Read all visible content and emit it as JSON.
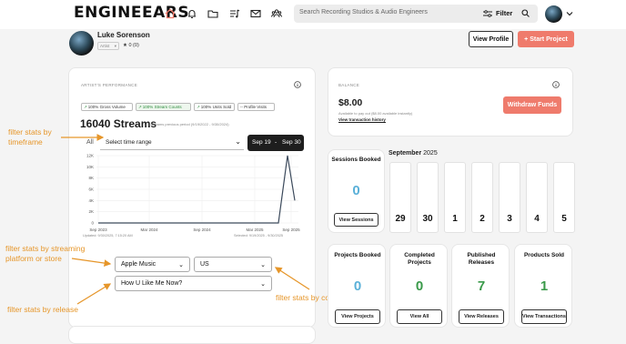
{
  "header": {
    "logo": "ENGINEEARS",
    "search": {
      "placeholder": "Search Recording Studios & Audio Engineers"
    },
    "filter_label": "Filter"
  },
  "profile": {
    "name": "Luke Sorenson",
    "role": "Artist",
    "rating": "0 (0)",
    "view_profile_label": "View Profile",
    "start_project_label": "+ Start Project"
  },
  "performance": {
    "section_title": "ARTIST'S PERFORMANCE",
    "chips": [
      {
        "value": "100%",
        "label": "Gross Volume"
      },
      {
        "value": "100%",
        "label": "Stream Counts"
      },
      {
        "value": "100%",
        "label": "Units Sold"
      },
      {
        "value": "--",
        "label": "Profile Visits"
      }
    ],
    "streams_value": "16040 Streams",
    "streams_note": "0 Streams previous period (9/19/2022 - 9/30/2024)",
    "all_label": "All",
    "time_range_label": "Select time range",
    "date_start": "Sep 19",
    "date_sep": "-",
    "date_end": "Sep 30",
    "updated_note": "Updated: 9/30/2025, 7:15:20 AM",
    "selected_note": "Selected: 9/19/2025 - 9/30/2025",
    "platform_value": "Apple Music",
    "country_value": "US",
    "release_value": "How U Like Me Now?"
  },
  "chart_data": {
    "type": "line",
    "y_ticks": [
      "12K",
      "10K",
      "8K",
      "6K",
      "4K",
      "2K",
      "0"
    ],
    "x_ticks": [
      "Sep 2023",
      "Mar 2024",
      "Sep 2024",
      "Mar 2025",
      "Sep 2025"
    ],
    "ylim": [
      0,
      12000
    ],
    "series": [
      {
        "x": [
          "Sep 2023",
          "Mar 2024",
          "Sep 2024",
          "Mar 2025",
          "Aug 2025",
          "Sep 2025",
          "Sep 2025"
        ],
        "values": [
          0,
          0,
          0,
          0,
          0,
          12000,
          4000
        ]
      }
    ],
    "grid": true,
    "color": "#3c4a5c"
  },
  "balance": {
    "section_title": "BALANCE",
    "amount": "$8.00",
    "available_note": "Available to pay out ($8.00 available instantly)",
    "history_link": "View transaction history",
    "withdraw_label": "Withdraw Funds"
  },
  "sessions": {
    "title": "Sessions Booked",
    "value": "0",
    "button": "View Sessions"
  },
  "calendar": {
    "month": "September",
    "year": "2025",
    "days": [
      "29",
      "30",
      "1",
      "2",
      "3",
      "4",
      "5"
    ]
  },
  "stats": [
    {
      "title": "Projects Booked",
      "value": "0",
      "button": "View Projects",
      "color": "#5ab0d8"
    },
    {
      "title": "Completed Projects",
      "value": "0",
      "button": "View All",
      "color": "#3a9a4a"
    },
    {
      "title": "Published Releases",
      "value": "7",
      "button": "View Releases",
      "color": "#3a9a4a"
    },
    {
      "title": "Products Sold",
      "value": "1",
      "button": "View Transactions",
      "color": "#3a9a4a"
    }
  ],
  "annotations": {
    "timeframe": [
      "filter stats by",
      "timeframe"
    ],
    "platform": [
      "filter stats by streaming",
      "platform or store"
    ],
    "release": "filter stats by release",
    "country": "filter stats by country"
  },
  "colors": {
    "accent": "#ef7b6c",
    "annotation": "#e6962a",
    "blue_stat": "#5ab0d8",
    "green_stat": "#3a9a4a"
  }
}
